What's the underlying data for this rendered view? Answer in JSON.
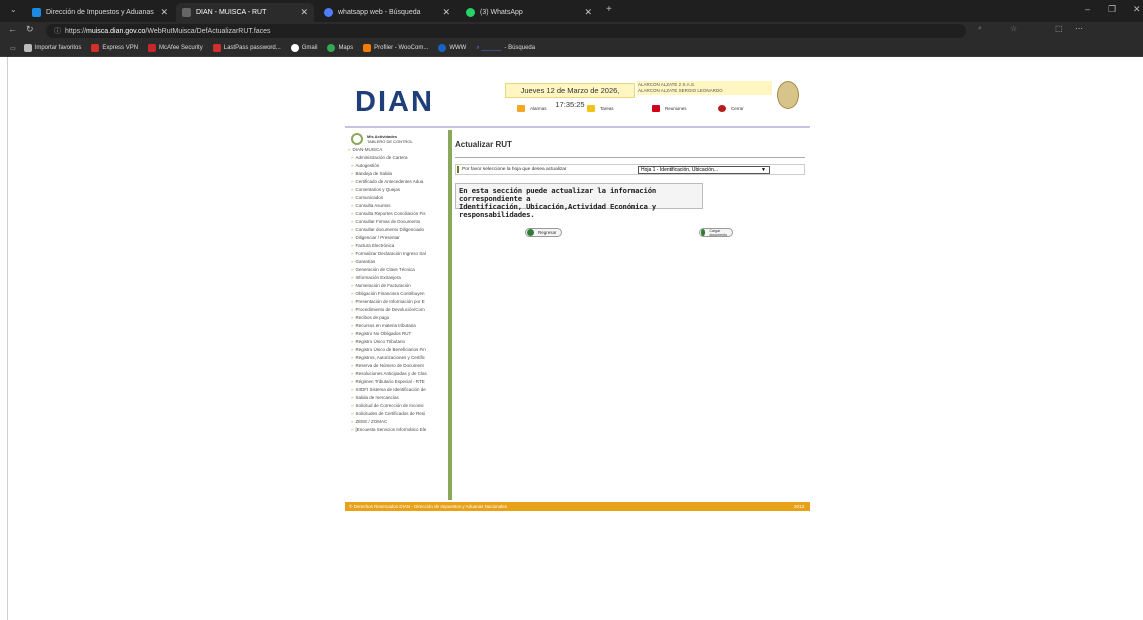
{
  "browser": {
    "tabs": [
      {
        "label": "Dirección de Impuestos y Aduanas",
        "active": false,
        "favicon_color": "#1e88e5"
      },
      {
        "label": "DIAN - MUISCA - RUT",
        "active": true,
        "favicon_color": "#dddddd"
      },
      {
        "label": "whatsapp web - Búsqueda",
        "active": false,
        "favicon_color": "#4f7fff"
      },
      {
        "label": "(3) WhatsApp",
        "active": false,
        "favicon_color": "#25d366"
      }
    ],
    "url_prefix": "https://",
    "url_host": "muisca.dian.gov.co",
    "url_path": "/WebRutMuisca/DefActualizarRUT.faces",
    "bookmarks": [
      {
        "label": "Importar favoritos",
        "color": "#cccccc"
      },
      {
        "label": "Express VPN",
        "color": "#d32f2f"
      },
      {
        "label": "McAfee Security",
        "color": "#c62828"
      },
      {
        "label": "LastPass password...",
        "color": "#d32f2f"
      },
      {
        "label": "Gmail",
        "color": "#ffffff"
      },
      {
        "label": "Maps",
        "color": "#34a853"
      },
      {
        "label": "Profiler - WooCom...",
        "color": "#f57c00"
      },
      {
        "label": "WWW",
        "color": "#1565c0"
      },
      {
        "label": "- Búsqueda",
        "color": "#1565c0"
      }
    ]
  },
  "header": {
    "logo": "DIAN",
    "date": "Jueves 12 de Marzo de 2026, 17:35:25",
    "user_line1": "ALARCON ALZATE 2 S.A.S.",
    "user_line2": "ALARCON ALZATE SERGIO LEONARDO",
    "links": [
      {
        "label": "Alarmas",
        "color": "#f5a623"
      },
      {
        "label": "Tareas",
        "color": "#f0c419"
      },
      {
        "label": "Reuniones",
        "color": "#d0021b"
      },
      {
        "label": "Cerrar",
        "color": "#b71c1c"
      }
    ]
  },
  "sidebar": {
    "title_line1": "Mis Actividades",
    "title_line2": "TABLERO DE CONTROL",
    "root": "DIAN-MUISCA",
    "items": [
      "Administración de Cartera",
      "Autogestión",
      "Bandeja de Salida",
      "Certificado de Antecedentes Adua",
      "Comentarios y Quejas",
      "Comunicados",
      "Consulta Asuntos",
      "Consulta Reportes Conciliación Fis",
      "Consultar Firmas de Documento",
      "Consultar documento Diligenciado",
      "Diligenciar / Presentar",
      "Factura Electrónica",
      "Formalizar Declaración Ingreso Sal",
      "Garantías",
      "Generación de Clave Técnica",
      "Información Extranjera",
      "Numeración de Facturación",
      "Obligación Financiera Contribuyen",
      "Presentación de Información por E",
      "Procedimiento de Devolución/Com",
      "Recibos de pago",
      "Recursos en materia tributaria",
      "Registro No Obligados RUT",
      "Registro Único Tributario",
      "Registro Único de Beneficiarios Fin",
      "Registros, Autorizaciones y Certific",
      "Reserva de Número de Document",
      "Resoluciones Anticipadas y de Clas",
      "Régimen Tributario Especial - RTE",
      "SIIDFI Sistema de Identificación de",
      "Salida de mercancías",
      "Solicitud de Corrección de Inconsi",
      "Solicitudes de Certificados de Resi",
      "ZEEE / ZOMAC",
      "[Encuesta Servicios Informático Ele"
    ]
  },
  "content": {
    "title": "Actualizar RUT",
    "select_label": "Por favor seleccione la hoja que desea actualizar",
    "select_value": "Hoja 1 - Identificación, Ubicación...",
    "info_line1": "En esta sección puede actualizar la información correspondiente a",
    "info_line2": "Identificación, Ubicación,Actividad Económica y responsabilidades.",
    "btn_back": "Regresar",
    "btn_load": "Cargar documento"
  },
  "footer": {
    "text": "© Derechos Reservados DIAN - Dirección de Impuestos y Aduanas Nacionales",
    "year": "2013"
  }
}
